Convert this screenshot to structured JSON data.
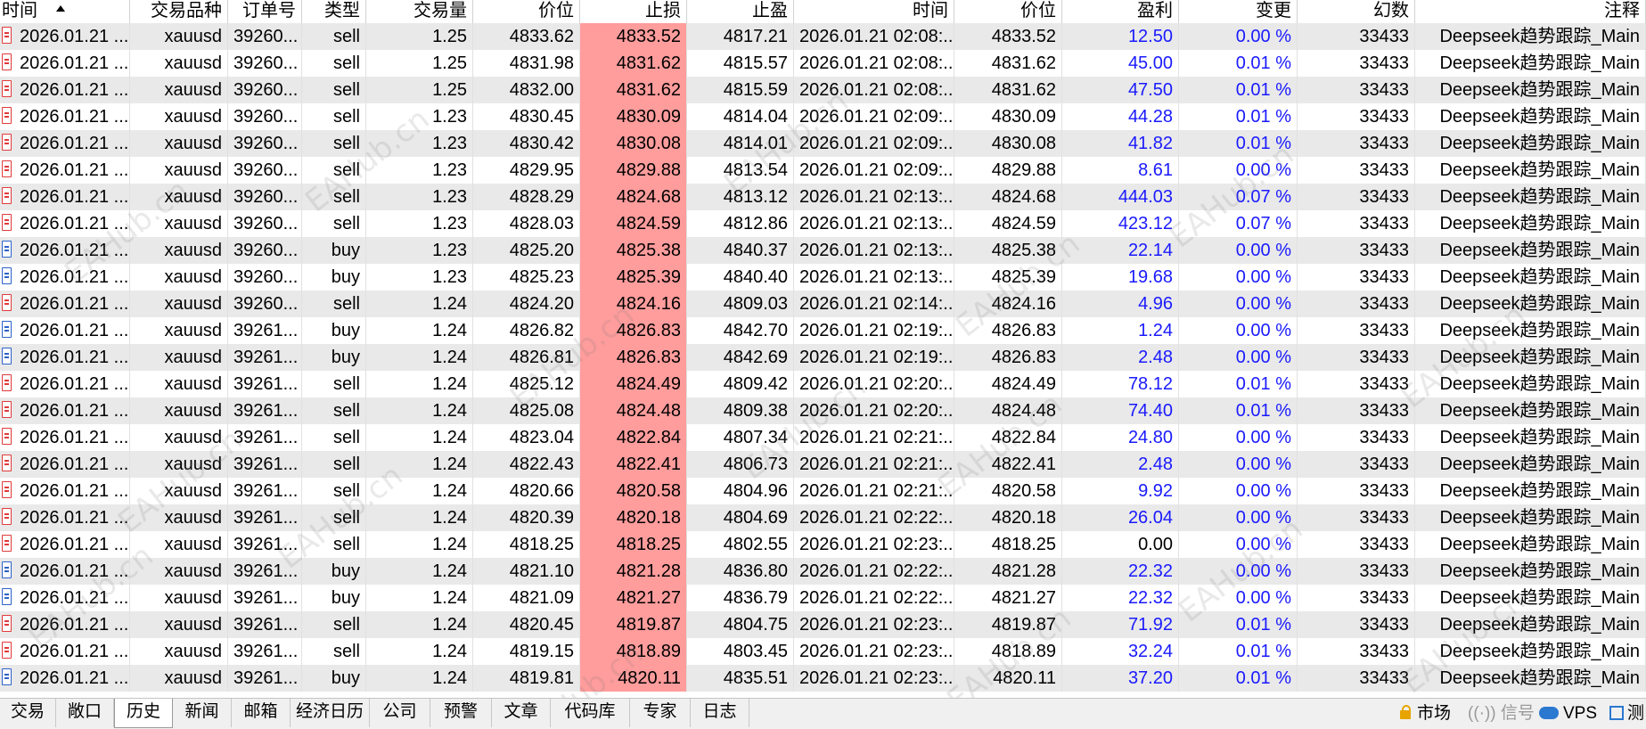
{
  "columns": {
    "time": "时间",
    "symbol": "交易品种",
    "ticket": "订单号",
    "type": "类型",
    "volume": "交易量",
    "price": "价位",
    "sl": "止损",
    "tp": "止盈",
    "close_time": "时间",
    "close_price": "价位",
    "profit": "盈利",
    "change": "变更",
    "magic": "幻数",
    "comment": "注释"
  },
  "rows": [
    {
      "time": "2026.01.21 ...",
      "symbol": "xauusd",
      "ticket": "39260...",
      "type": "sell",
      "volume": "1.25",
      "price": "4833.62",
      "sl": "4833.52",
      "tp": "4817.21",
      "close_time": "2026.01.21 02:08:...",
      "close_price": "4833.52",
      "profit": "12.50",
      "change": "0.00 %",
      "magic": "33433",
      "comment": "Deepseek趋势跟踪_Main"
    },
    {
      "time": "2026.01.21 ...",
      "symbol": "xauusd",
      "ticket": "39260...",
      "type": "sell",
      "volume": "1.25",
      "price": "4831.98",
      "sl": "4831.62",
      "tp": "4815.57",
      "close_time": "2026.01.21 02:08:...",
      "close_price": "4831.62",
      "profit": "45.00",
      "change": "0.01 %",
      "magic": "33433",
      "comment": "Deepseek趋势跟踪_Main"
    },
    {
      "time": "2026.01.21 ...",
      "symbol": "xauusd",
      "ticket": "39260...",
      "type": "sell",
      "volume": "1.25",
      "price": "4832.00",
      "sl": "4831.62",
      "tp": "4815.59",
      "close_time": "2026.01.21 02:08:...",
      "close_price": "4831.62",
      "profit": "47.50",
      "change": "0.01 %",
      "magic": "33433",
      "comment": "Deepseek趋势跟踪_Main"
    },
    {
      "time": "2026.01.21 ...",
      "symbol": "xauusd",
      "ticket": "39260...",
      "type": "sell",
      "volume": "1.23",
      "price": "4830.45",
      "sl": "4830.09",
      "tp": "4814.04",
      "close_time": "2026.01.21 02:09:...",
      "close_price": "4830.09",
      "profit": "44.28",
      "change": "0.01 %",
      "magic": "33433",
      "comment": "Deepseek趋势跟踪_Main"
    },
    {
      "time": "2026.01.21 ...",
      "symbol": "xauusd",
      "ticket": "39260...",
      "type": "sell",
      "volume": "1.23",
      "price": "4830.42",
      "sl": "4830.08",
      "tp": "4814.01",
      "close_time": "2026.01.21 02:09:...",
      "close_price": "4830.08",
      "profit": "41.82",
      "change": "0.01 %",
      "magic": "33433",
      "comment": "Deepseek趋势跟踪_Main"
    },
    {
      "time": "2026.01.21 ...",
      "symbol": "xauusd",
      "ticket": "39260...",
      "type": "sell",
      "volume": "1.23",
      "price": "4829.95",
      "sl": "4829.88",
      "tp": "4813.54",
      "close_time": "2026.01.21 02:09:...",
      "close_price": "4829.88",
      "profit": "8.61",
      "change": "0.00 %",
      "magic": "33433",
      "comment": "Deepseek趋势跟踪_Main"
    },
    {
      "time": "2026.01.21 ...",
      "symbol": "xauusd",
      "ticket": "39260...",
      "type": "sell",
      "volume": "1.23",
      "price": "4828.29",
      "sl": "4824.68",
      "tp": "4813.12",
      "close_time": "2026.01.21 02:13:...",
      "close_price": "4824.68",
      "profit": "444.03",
      "change": "0.07 %",
      "magic": "33433",
      "comment": "Deepseek趋势跟踪_Main"
    },
    {
      "time": "2026.01.21 ...",
      "symbol": "xauusd",
      "ticket": "39260...",
      "type": "sell",
      "volume": "1.23",
      "price": "4828.03",
      "sl": "4824.59",
      "tp": "4812.86",
      "close_time": "2026.01.21 02:13:...",
      "close_price": "4824.59",
      "profit": "423.12",
      "change": "0.07 %",
      "magic": "33433",
      "comment": "Deepseek趋势跟踪_Main"
    },
    {
      "time": "2026.01.21 ...",
      "symbol": "xauusd",
      "ticket": "39260...",
      "type": "buy",
      "volume": "1.23",
      "price": "4825.20",
      "sl": "4825.38",
      "tp": "4840.37",
      "close_time": "2026.01.21 02:13:...",
      "close_price": "4825.38",
      "profit": "22.14",
      "change": "0.00 %",
      "magic": "33433",
      "comment": "Deepseek趋势跟踪_Main"
    },
    {
      "time": "2026.01.21 ...",
      "symbol": "xauusd",
      "ticket": "39260...",
      "type": "buy",
      "volume": "1.23",
      "price": "4825.23",
      "sl": "4825.39",
      "tp": "4840.40",
      "close_time": "2026.01.21 02:13:...",
      "close_price": "4825.39",
      "profit": "19.68",
      "change": "0.00 %",
      "magic": "33433",
      "comment": "Deepseek趋势跟踪_Main"
    },
    {
      "time": "2026.01.21 ...",
      "symbol": "xauusd",
      "ticket": "39260...",
      "type": "sell",
      "volume": "1.24",
      "price": "4824.20",
      "sl": "4824.16",
      "tp": "4809.03",
      "close_time": "2026.01.21 02:14:...",
      "close_price": "4824.16",
      "profit": "4.96",
      "change": "0.00 %",
      "magic": "33433",
      "comment": "Deepseek趋势跟踪_Main"
    },
    {
      "time": "2026.01.21 ...",
      "symbol": "xauusd",
      "ticket": "39261...",
      "type": "buy",
      "volume": "1.24",
      "price": "4826.82",
      "sl": "4826.83",
      "tp": "4842.70",
      "close_time": "2026.01.21 02:19:...",
      "close_price": "4826.83",
      "profit": "1.24",
      "change": "0.00 %",
      "magic": "33433",
      "comment": "Deepseek趋势跟踪_Main"
    },
    {
      "time": "2026.01.21 ...",
      "symbol": "xauusd",
      "ticket": "39261...",
      "type": "buy",
      "volume": "1.24",
      "price": "4826.81",
      "sl": "4826.83",
      "tp": "4842.69",
      "close_time": "2026.01.21 02:19:...",
      "close_price": "4826.83",
      "profit": "2.48",
      "change": "0.00 %",
      "magic": "33433",
      "comment": "Deepseek趋势跟踪_Main"
    },
    {
      "time": "2026.01.21 ...",
      "symbol": "xauusd",
      "ticket": "39261...",
      "type": "sell",
      "volume": "1.24",
      "price": "4825.12",
      "sl": "4824.49",
      "tp": "4809.42",
      "close_time": "2026.01.21 02:20:...",
      "close_price": "4824.49",
      "profit": "78.12",
      "change": "0.01 %",
      "magic": "33433",
      "comment": "Deepseek趋势跟踪_Main"
    },
    {
      "time": "2026.01.21 ...",
      "symbol": "xauusd",
      "ticket": "39261...",
      "type": "sell",
      "volume": "1.24",
      "price": "4825.08",
      "sl": "4824.48",
      "tp": "4809.38",
      "close_time": "2026.01.21 02:20:...",
      "close_price": "4824.48",
      "profit": "74.40",
      "change": "0.01 %",
      "magic": "33433",
      "comment": "Deepseek趋势跟踪_Main"
    },
    {
      "time": "2026.01.21 ...",
      "symbol": "xauusd",
      "ticket": "39261...",
      "type": "sell",
      "volume": "1.24",
      "price": "4823.04",
      "sl": "4822.84",
      "tp": "4807.34",
      "close_time": "2026.01.21 02:21:...",
      "close_price": "4822.84",
      "profit": "24.80",
      "change": "0.00 %",
      "magic": "33433",
      "comment": "Deepseek趋势跟踪_Main"
    },
    {
      "time": "2026.01.21 ...",
      "symbol": "xauusd",
      "ticket": "39261...",
      "type": "sell",
      "volume": "1.24",
      "price": "4822.43",
      "sl": "4822.41",
      "tp": "4806.73",
      "close_time": "2026.01.21 02:21:...",
      "close_price": "4822.41",
      "profit": "2.48",
      "change": "0.00 %",
      "magic": "33433",
      "comment": "Deepseek趋势跟踪_Main"
    },
    {
      "time": "2026.01.21 ...",
      "symbol": "xauusd",
      "ticket": "39261...",
      "type": "sell",
      "volume": "1.24",
      "price": "4820.66",
      "sl": "4820.58",
      "tp": "4804.96",
      "close_time": "2026.01.21 02:21:...",
      "close_price": "4820.58",
      "profit": "9.92",
      "change": "0.00 %",
      "magic": "33433",
      "comment": "Deepseek趋势跟踪_Main"
    },
    {
      "time": "2026.01.21 ...",
      "symbol": "xauusd",
      "ticket": "39261...",
      "type": "sell",
      "volume": "1.24",
      "price": "4820.39",
      "sl": "4820.18",
      "tp": "4804.69",
      "close_time": "2026.01.21 02:22:...",
      "close_price": "4820.18",
      "profit": "26.04",
      "change": "0.00 %",
      "magic": "33433",
      "comment": "Deepseek趋势跟踪_Main"
    },
    {
      "time": "2026.01.21 ...",
      "symbol": "xauusd",
      "ticket": "39261...",
      "type": "sell",
      "volume": "1.24",
      "price": "4818.25",
      "sl": "4818.25",
      "tp": "4802.55",
      "close_time": "2026.01.21 02:23:...",
      "close_price": "4818.25",
      "profit": "0.00",
      "change": "0.00 %",
      "magic": "33433",
      "comment": "Deepseek趋势跟踪_Main"
    },
    {
      "time": "2026.01.21 ...",
      "symbol": "xauusd",
      "ticket": "39261...",
      "type": "buy",
      "volume": "1.24",
      "price": "4821.10",
      "sl": "4821.28",
      "tp": "4836.80",
      "close_time": "2026.01.21 02:22:...",
      "close_price": "4821.28",
      "profit": "22.32",
      "change": "0.00 %",
      "magic": "33433",
      "comment": "Deepseek趋势跟踪_Main"
    },
    {
      "time": "2026.01.21 ...",
      "symbol": "xauusd",
      "ticket": "39261...",
      "type": "buy",
      "volume": "1.24",
      "price": "4821.09",
      "sl": "4821.27",
      "tp": "4836.79",
      "close_time": "2026.01.21 02:22:...",
      "close_price": "4821.27",
      "profit": "22.32",
      "change": "0.00 %",
      "magic": "33433",
      "comment": "Deepseek趋势跟踪_Main"
    },
    {
      "time": "2026.01.21 ...",
      "symbol": "xauusd",
      "ticket": "39261...",
      "type": "sell",
      "volume": "1.24",
      "price": "4820.45",
      "sl": "4819.87",
      "tp": "4804.75",
      "close_time": "2026.01.21 02:23:...",
      "close_price": "4819.87",
      "profit": "71.92",
      "change": "0.01 %",
      "magic": "33433",
      "comment": "Deepseek趋势跟踪_Main"
    },
    {
      "time": "2026.01.21 ...",
      "symbol": "xauusd",
      "ticket": "39261...",
      "type": "sell",
      "volume": "1.24",
      "price": "4819.15",
      "sl": "4818.89",
      "tp": "4803.45",
      "close_time": "2026.01.21 02:23:...",
      "close_price": "4818.89",
      "profit": "32.24",
      "change": "0.01 %",
      "magic": "33433",
      "comment": "Deepseek趋势跟踪_Main"
    },
    {
      "time": "2026.01.21 ...",
      "symbol": "xauusd",
      "ticket": "39261...",
      "type": "buy",
      "volume": "1.24",
      "price": "4819.81",
      "sl": "4820.11",
      "tp": "4835.51",
      "close_time": "2026.01.21 02:23:...",
      "close_price": "4820.11",
      "profit": "37.20",
      "change": "0.01 %",
      "magic": "33433",
      "comment": "Deepseek趋势跟踪_Main"
    }
  ],
  "tabs": [
    "交易",
    "敞口",
    "历史",
    "新闻",
    "邮箱",
    "经济日历",
    "公司",
    "预警",
    "文章",
    "代码库",
    "专家",
    "日志"
  ],
  "active_tab": "历史",
  "status": {
    "market": "市场",
    "signal": "((·)) 信号",
    "vps": "VPS",
    "tester": "测"
  },
  "watermark": "EAHub.cn",
  "colors": {
    "stop_loss_bg": "#ff9c9c",
    "profit_text": "#1a1aff",
    "sell_icon": "#e03a3a",
    "buy_icon": "#2a62c8",
    "alt_row": "#e9e9e9"
  }
}
